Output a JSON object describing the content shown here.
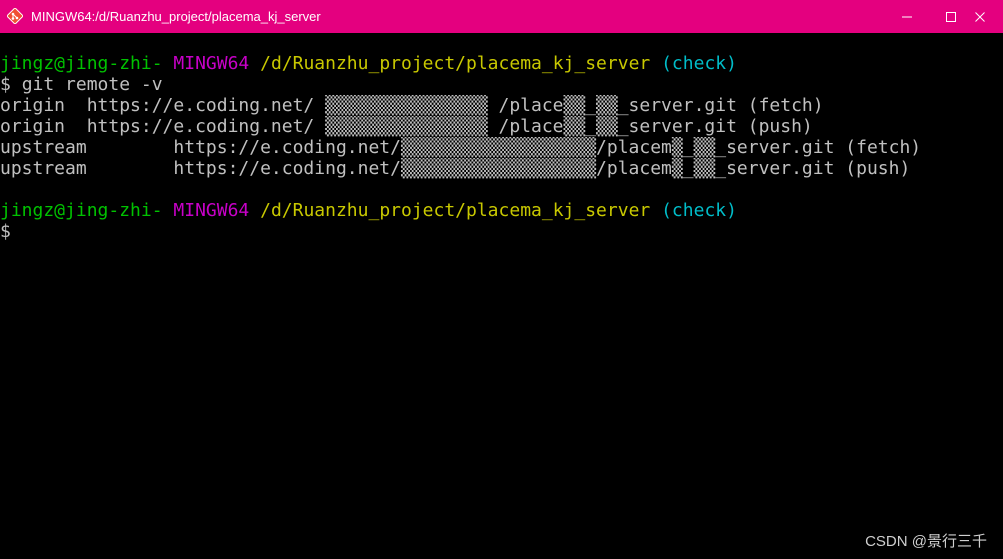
{
  "window": {
    "title": "MINGW64:/d/Ruanzhu_project/placema_kj_server",
    "title_bar_color": "#e4007f",
    "icon": "git-bash-icon"
  },
  "prompt": {
    "user_host": "jingz@jing-zhi-",
    "env": "MINGW64",
    "path": "/d/Ruanzhu_project/placema_kj_server",
    "branch": "(check)",
    "symbol": "$"
  },
  "terminal": {
    "command": "git remote -v",
    "output": [
      "origin  https://e.coding.net/ ▒▒▒▒▒▒▒▒▒▒▒▒▒▒▒ /place▒▒_▒▒_server.git (fetch)",
      "origin  https://e.coding.net/ ▒▒▒▒▒▒▒▒▒▒▒▒▒▒▒ /place▒▒_▒▒_server.git (push)",
      "upstream        https://e.coding.net/▒▒▒▒▒▒▒▒▒▒▒▒▒▒▒▒▒▒/placem▒_▒▒_server.git (fetch)",
      "upstream        https://e.coding.net/▒▒▒▒▒▒▒▒▒▒▒▒▒▒▒▒▒▒/placem▒_▒▒_server.git (push)"
    ]
  },
  "colors": {
    "user_host": "#00c200",
    "env": "#c800c8",
    "path": "#c8c800",
    "branch": "#00bcc8"
  },
  "watermark": "CSDN @景行三千"
}
